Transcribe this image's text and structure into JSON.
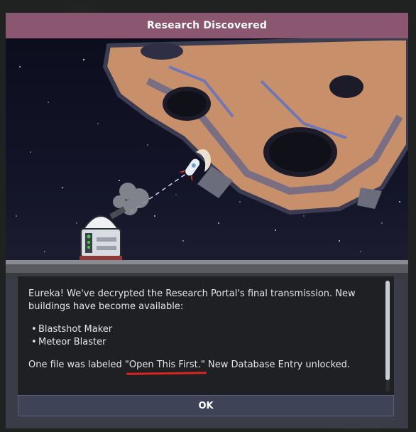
{
  "dialog": {
    "title": "Research Discovered",
    "message_intro": "Eureka! We've decrypted the Research Portal's final transmission. New buildings have become available:",
    "items": [
      {
        "label": "Blastshot Maker"
      },
      {
        "label": "Meteor Blaster"
      }
    ],
    "footer_before": "One file was labeled ",
    "footer_highlight": "\"Open This First.\"",
    "footer_after": " New Database Entry unlocked.",
    "ok_label": "OK"
  },
  "colors": {
    "title_bar": "#8a5670",
    "panel": "#1e2023",
    "button": "#3e4357",
    "underline": "#d7261f"
  }
}
